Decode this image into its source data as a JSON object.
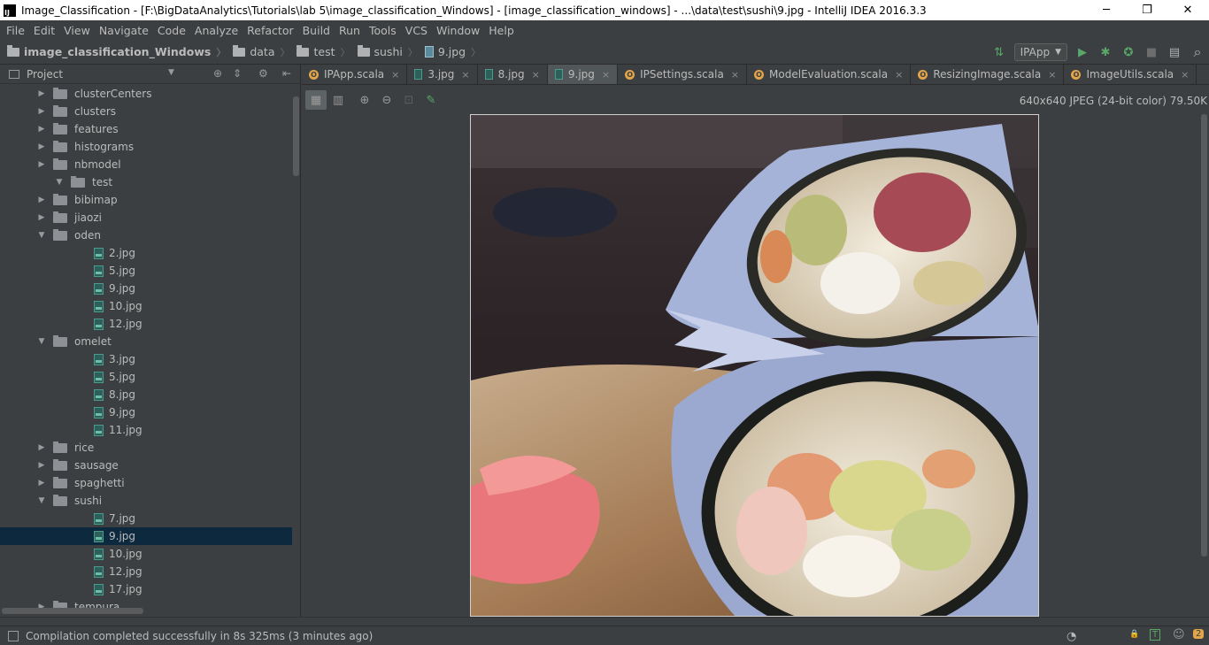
{
  "window": {
    "title": "Image_Classification - [F:\\BigDataAnalytics\\Tutorials\\lab 5\\image_classification_Windows] - [image_classification_windows] - ...\\data\\test\\sushi\\9.jpg - IntelliJ IDEA 2016.3.3",
    "app_icon_text": "IJ",
    "minimize": "─",
    "restore": "❐",
    "close": "✕"
  },
  "menu": [
    "File",
    "Edit",
    "View",
    "Navigate",
    "Code",
    "Analyze",
    "Refactor",
    "Build",
    "Run",
    "Tools",
    "VCS",
    "Window",
    "Help"
  ],
  "breadcrumb": [
    "image_classification_Windows",
    "data",
    "test",
    "sushi",
    "9.jpg"
  ],
  "toolbar": {
    "run_config": "IPApp",
    "run_config_arrow": "▼",
    "build_icon": "⇅",
    "run_icon": "▶",
    "debug_icon": "✱",
    "coverage_icon": "✪",
    "stop_icon": "■",
    "structure_icon": "▤",
    "search_icon": "⌕"
  },
  "project_panel": {
    "title": "Project",
    "dropdown": "▼",
    "icons": [
      "⊕",
      "⇕",
      "⚙",
      "⇤"
    ],
    "tree": [
      {
        "label": "clusterCenters",
        "type": "folder",
        "level": 1,
        "expanded": false
      },
      {
        "label": "clusters",
        "type": "folder",
        "level": 1,
        "expanded": false
      },
      {
        "label": "features",
        "type": "folder",
        "level": 1,
        "expanded": false
      },
      {
        "label": "histograms",
        "type": "folder",
        "level": 1,
        "expanded": false
      },
      {
        "label": "nbmodel",
        "type": "folder",
        "level": 1,
        "expanded": false
      },
      {
        "label": "test",
        "type": "folder",
        "level": 0,
        "expanded": true
      },
      {
        "label": "bibimap",
        "type": "folder",
        "level": 1,
        "expanded": false
      },
      {
        "label": "jiaozi",
        "type": "folder",
        "level": 1,
        "expanded": false
      },
      {
        "label": "oden",
        "type": "folder",
        "level": 1,
        "expanded": true
      },
      {
        "label": "2.jpg",
        "type": "file",
        "level": 2
      },
      {
        "label": "5.jpg",
        "type": "file",
        "level": 2
      },
      {
        "label": "9.jpg",
        "type": "file",
        "level": 2
      },
      {
        "label": "10.jpg",
        "type": "file",
        "level": 2
      },
      {
        "label": "12.jpg",
        "type": "file",
        "level": 2
      },
      {
        "label": "omelet",
        "type": "folder",
        "level": 1,
        "expanded": true
      },
      {
        "label": "3.jpg",
        "type": "file",
        "level": 2
      },
      {
        "label": "5.jpg",
        "type": "file",
        "level": 2
      },
      {
        "label": "8.jpg",
        "type": "file",
        "level": 2
      },
      {
        "label": "9.jpg",
        "type": "file",
        "level": 2
      },
      {
        "label": "11.jpg",
        "type": "file",
        "level": 2
      },
      {
        "label": "rice",
        "type": "folder",
        "level": 1,
        "expanded": false
      },
      {
        "label": "sausage",
        "type": "folder",
        "level": 1,
        "expanded": false
      },
      {
        "label": "spaghetti",
        "type": "folder",
        "level": 1,
        "expanded": false
      },
      {
        "label": "sushi",
        "type": "folder",
        "level": 1,
        "expanded": true
      },
      {
        "label": "7.jpg",
        "type": "file",
        "level": 2
      },
      {
        "label": "9.jpg",
        "type": "file",
        "level": 2,
        "selected": true
      },
      {
        "label": "10.jpg",
        "type": "file",
        "level": 2
      },
      {
        "label": "12.jpg",
        "type": "file",
        "level": 2
      },
      {
        "label": "17.jpg",
        "type": "file",
        "level": 2
      },
      {
        "label": "tempura",
        "type": "folder",
        "level": 1,
        "expanded": false
      }
    ]
  },
  "tabs": [
    {
      "label": "IPApp.scala",
      "kind": "scala"
    },
    {
      "label": "3.jpg",
      "kind": "image"
    },
    {
      "label": "8.jpg",
      "kind": "image"
    },
    {
      "label": "9.jpg",
      "kind": "image",
      "active": true
    },
    {
      "label": "IPSettings.scala",
      "kind": "scala"
    },
    {
      "label": "ModelEvaluation.scala",
      "kind": "scala"
    },
    {
      "label": "ResizingImage.scala",
      "kind": "scala"
    },
    {
      "label": "ImageUtils.scala",
      "kind": "scala"
    }
  ],
  "tab_close": "×",
  "scala_badge": "O",
  "image_toolbar": {
    "icons": [
      "▦",
      "▥",
      "⊕",
      "⊖",
      "⊡",
      "✎"
    ],
    "info": "640x640 JPEG (24-bit color) 79.50K"
  },
  "status": {
    "message": "Compilation completed successfully in 8s 325ms (3 minutes ago)",
    "icons": [
      "◔",
      "🔒",
      "T",
      "☺",
      "2"
    ]
  },
  "colors": {
    "background": "#3c3f41",
    "selection": "#0d293e",
    "accent_scala": "#e2a549",
    "run_green": "#59a869"
  }
}
